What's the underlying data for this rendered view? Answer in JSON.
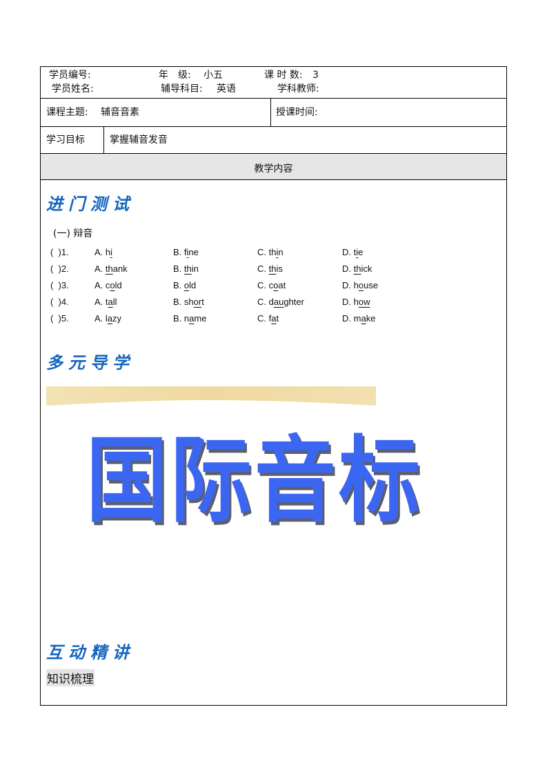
{
  "header": {
    "student_id_label": "学员编号:",
    "grade_label": "年　级:",
    "grade_value": "小五",
    "hours_label": "课 时 数:",
    "hours_value": "3",
    "student_name_label": "学员姓名:",
    "subject_label": "辅导科目:",
    "subject_value": "英语",
    "teacher_label": "学科教师:"
  },
  "topic": {
    "label": "课程主题:",
    "value": "辅音音素",
    "time_label": "授课时间:"
  },
  "goal": {
    "label": "学习目标",
    "value": "掌握辅音发音"
  },
  "content_header": "教学内容",
  "sections": {
    "entry_test": "进门测试",
    "guided_learning": "多元导学",
    "interactive": "互动精讲"
  },
  "exercise": {
    "heading": "(一) 辩音",
    "questions": [
      {
        "num": "(  )1.",
        "options": [
          {
            "prefix": "A. ",
            "pre": "h",
            "u": "i",
            "post": ""
          },
          {
            "prefix": "B. ",
            "pre": "f",
            "u": "i",
            "post": "ne"
          },
          {
            "prefix": "C. ",
            "pre": "th",
            "u": "i",
            "post": "n"
          },
          {
            "prefix": "D. ",
            "pre": "t",
            "u": "i",
            "post": "e"
          }
        ]
      },
      {
        "num": "(  )2.",
        "options": [
          {
            "prefix": "A. ",
            "pre": "",
            "u": "th",
            "post": "ank"
          },
          {
            "prefix": "B. ",
            "pre": "",
            "u": "th",
            "post": "in"
          },
          {
            "prefix": "C. ",
            "pre": "",
            "u": "th",
            "post": "is"
          },
          {
            "prefix": "D. ",
            "pre": "",
            "u": "th",
            "post": "ick"
          }
        ]
      },
      {
        "num": "(  )3.",
        "options": [
          {
            "prefix": "A. ",
            "pre": "c",
            "u": "o",
            "post": "ld"
          },
          {
            "prefix": "B. ",
            "pre": "",
            "u": "o",
            "post": "ld"
          },
          {
            "prefix": "C. ",
            "pre": "c",
            "u": "o",
            "post": "at"
          },
          {
            "prefix": "D. ",
            "pre": "h",
            "u": "o",
            "post": "use"
          }
        ]
      },
      {
        "num": "(  )4.",
        "options": [
          {
            "prefix": "A. ",
            "pre": "t",
            "u": "a",
            "post": "ll"
          },
          {
            "prefix": "B. ",
            "pre": "sh",
            "u": "or",
            "post": "t"
          },
          {
            "prefix": "C. ",
            "pre": "d",
            "u": "au",
            "post": "ghter"
          },
          {
            "prefix": "D. ",
            "pre": "h",
            "u": "ow",
            "post": ""
          }
        ]
      },
      {
        "num": "(  )5.",
        "options": [
          {
            "prefix": "A. ",
            "pre": "l",
            "u": "a",
            "post": "zy"
          },
          {
            "prefix": "B. ",
            "pre": "n",
            "u": "a",
            "post": "me"
          },
          {
            "prefix": "C. ",
            "pre": "f",
            "u": "a",
            "post": "t"
          },
          {
            "prefix": "D. ",
            "pre": "m",
            "u": "a",
            "post": "ke"
          }
        ]
      }
    ]
  },
  "image_title": "国际音标",
  "knowledge_label": "知识梳理",
  "colors": {
    "section_title": "#1565c0",
    "big_title": "#3b66f2",
    "banner": "#f0dca8",
    "content_header_bg": "#e6e6e6"
  }
}
